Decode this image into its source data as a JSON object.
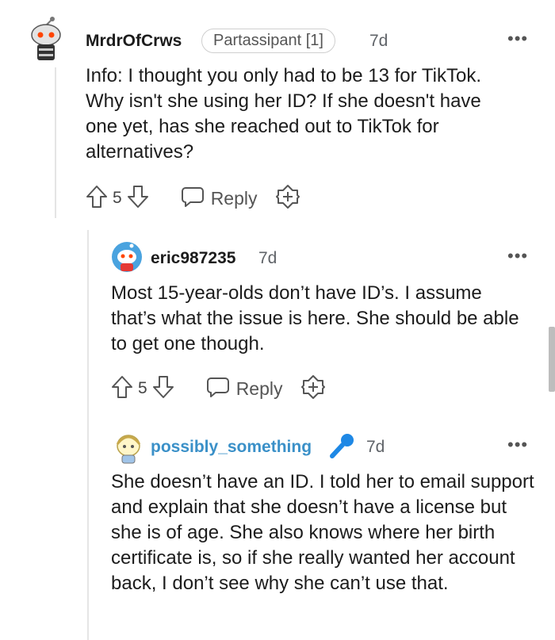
{
  "comments": [
    {
      "username": "MrdrOfCrws",
      "flair": "Partassipant [1]",
      "time": "7d",
      "text": "Info: I thought you only had to be 13 for TikTok. Why isn't she using her ID? If she doesn't have one yet, has she reached out to TikTok for alternatives?",
      "votes": "5",
      "reply_label": "Reply"
    },
    {
      "username": "eric987235",
      "time": "7d",
      "text": "Most 15-year-olds don’t have ID’s. I assume that’s what the issue is here. She should be able to get one though.",
      "votes": "5",
      "reply_label": "Reply"
    },
    {
      "username": "possibly_something",
      "time": "7d",
      "text": "She doesn’t have an ID. I told her to email support and explain that she doesn’t have a license but she is of age. She also knows where her birth certificate is, so if she really wanted her account back, I don’t see why she can’t use that."
    }
  ],
  "more_menu_label": "•••",
  "colors": {
    "op_accent": "#ff4500",
    "blue_username": "#3a90c8",
    "mic_icon": "#1e88e5"
  }
}
